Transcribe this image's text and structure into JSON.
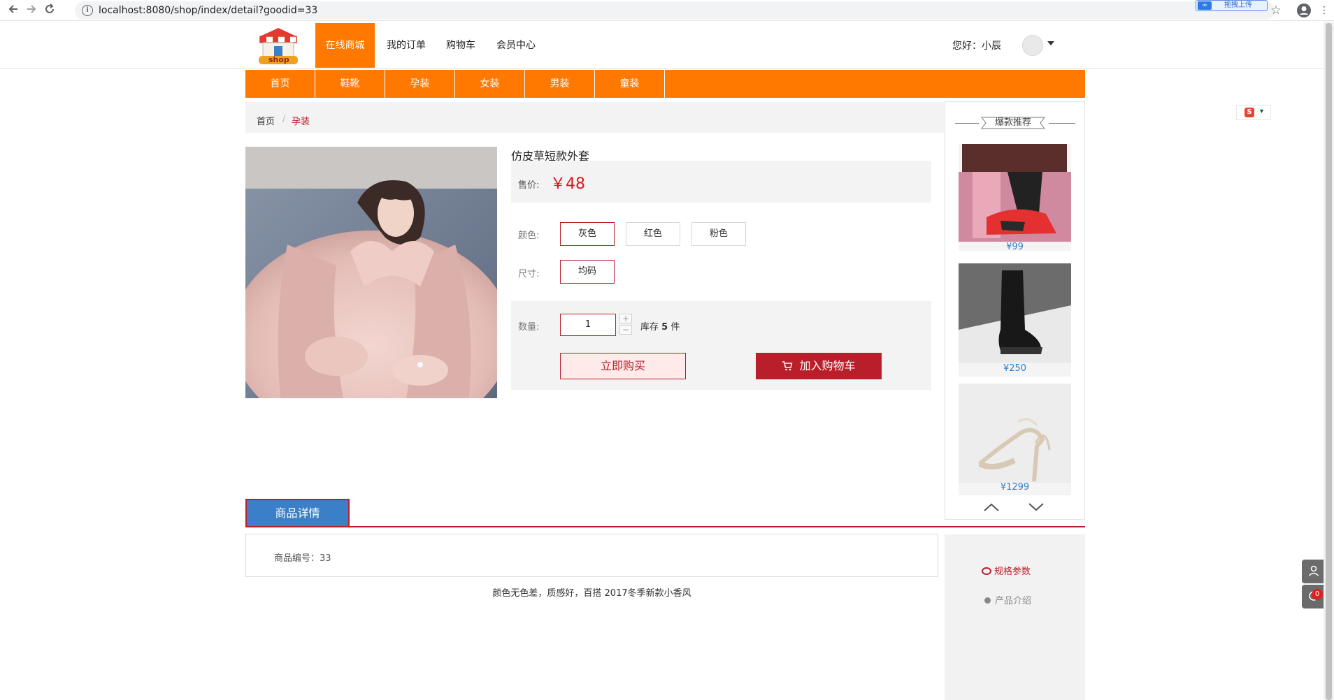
{
  "browser": {
    "url": "localhost:8080/shop/index/detail?goodid=33",
    "ext_label": "拖拽上传",
    "icons": [
      "back-arrow-icon",
      "forward-arrow-icon",
      "reload-icon",
      "info-icon",
      "star-icon",
      "account-icon",
      "menu-dots-icon"
    ]
  },
  "header": {
    "logo_text": "shop",
    "nav": [
      {
        "label": "在线商城",
        "active": true
      },
      {
        "label": "我的订单",
        "active": false
      },
      {
        "label": "购物车",
        "active": false
      },
      {
        "label": "会员中心",
        "active": false
      }
    ],
    "greeting": "您好：小辰"
  },
  "categories": [
    "首页",
    "鞋靴",
    "孕装",
    "女装",
    "男装",
    "童装"
  ],
  "breadcrumb": {
    "home": "首页",
    "separator": "/",
    "current": "孕装"
  },
  "product": {
    "title": "仿皮草短款外套",
    "price_label": "售价:",
    "price": "￥48",
    "color_label": "颜色:",
    "colors": [
      "灰色",
      "红色",
      "粉色"
    ],
    "selected_color": "灰色",
    "size_label": "尺寸:",
    "sizes": [
      "均码"
    ],
    "qty_label": "数量:",
    "qty": "1",
    "stock_prefix": "库存",
    "stock_count": "5",
    "stock_suffix": "件",
    "buy_now": "立即购买",
    "add_cart": "加入购物车"
  },
  "hot": {
    "title": "爆款推荐",
    "items": [
      {
        "price": "¥99"
      },
      {
        "price": "¥250"
      },
      {
        "price": "¥1299"
      }
    ]
  },
  "details": {
    "tab": "商品详情",
    "goods_no": "商品编号：33",
    "description": "颜色无色差，质感好，百搭 2017冬季新款小香风"
  },
  "side_nav": {
    "active": "规格参数",
    "item": "产品介绍"
  },
  "tools": {
    "badge_count": "0"
  },
  "colors": {
    "accent_orange": "#ff7800",
    "accent_red": "#b91f2a",
    "price_red": "#d7171f",
    "link_blue": "#2f7fca",
    "tab_blue": "#3a7fc7"
  }
}
